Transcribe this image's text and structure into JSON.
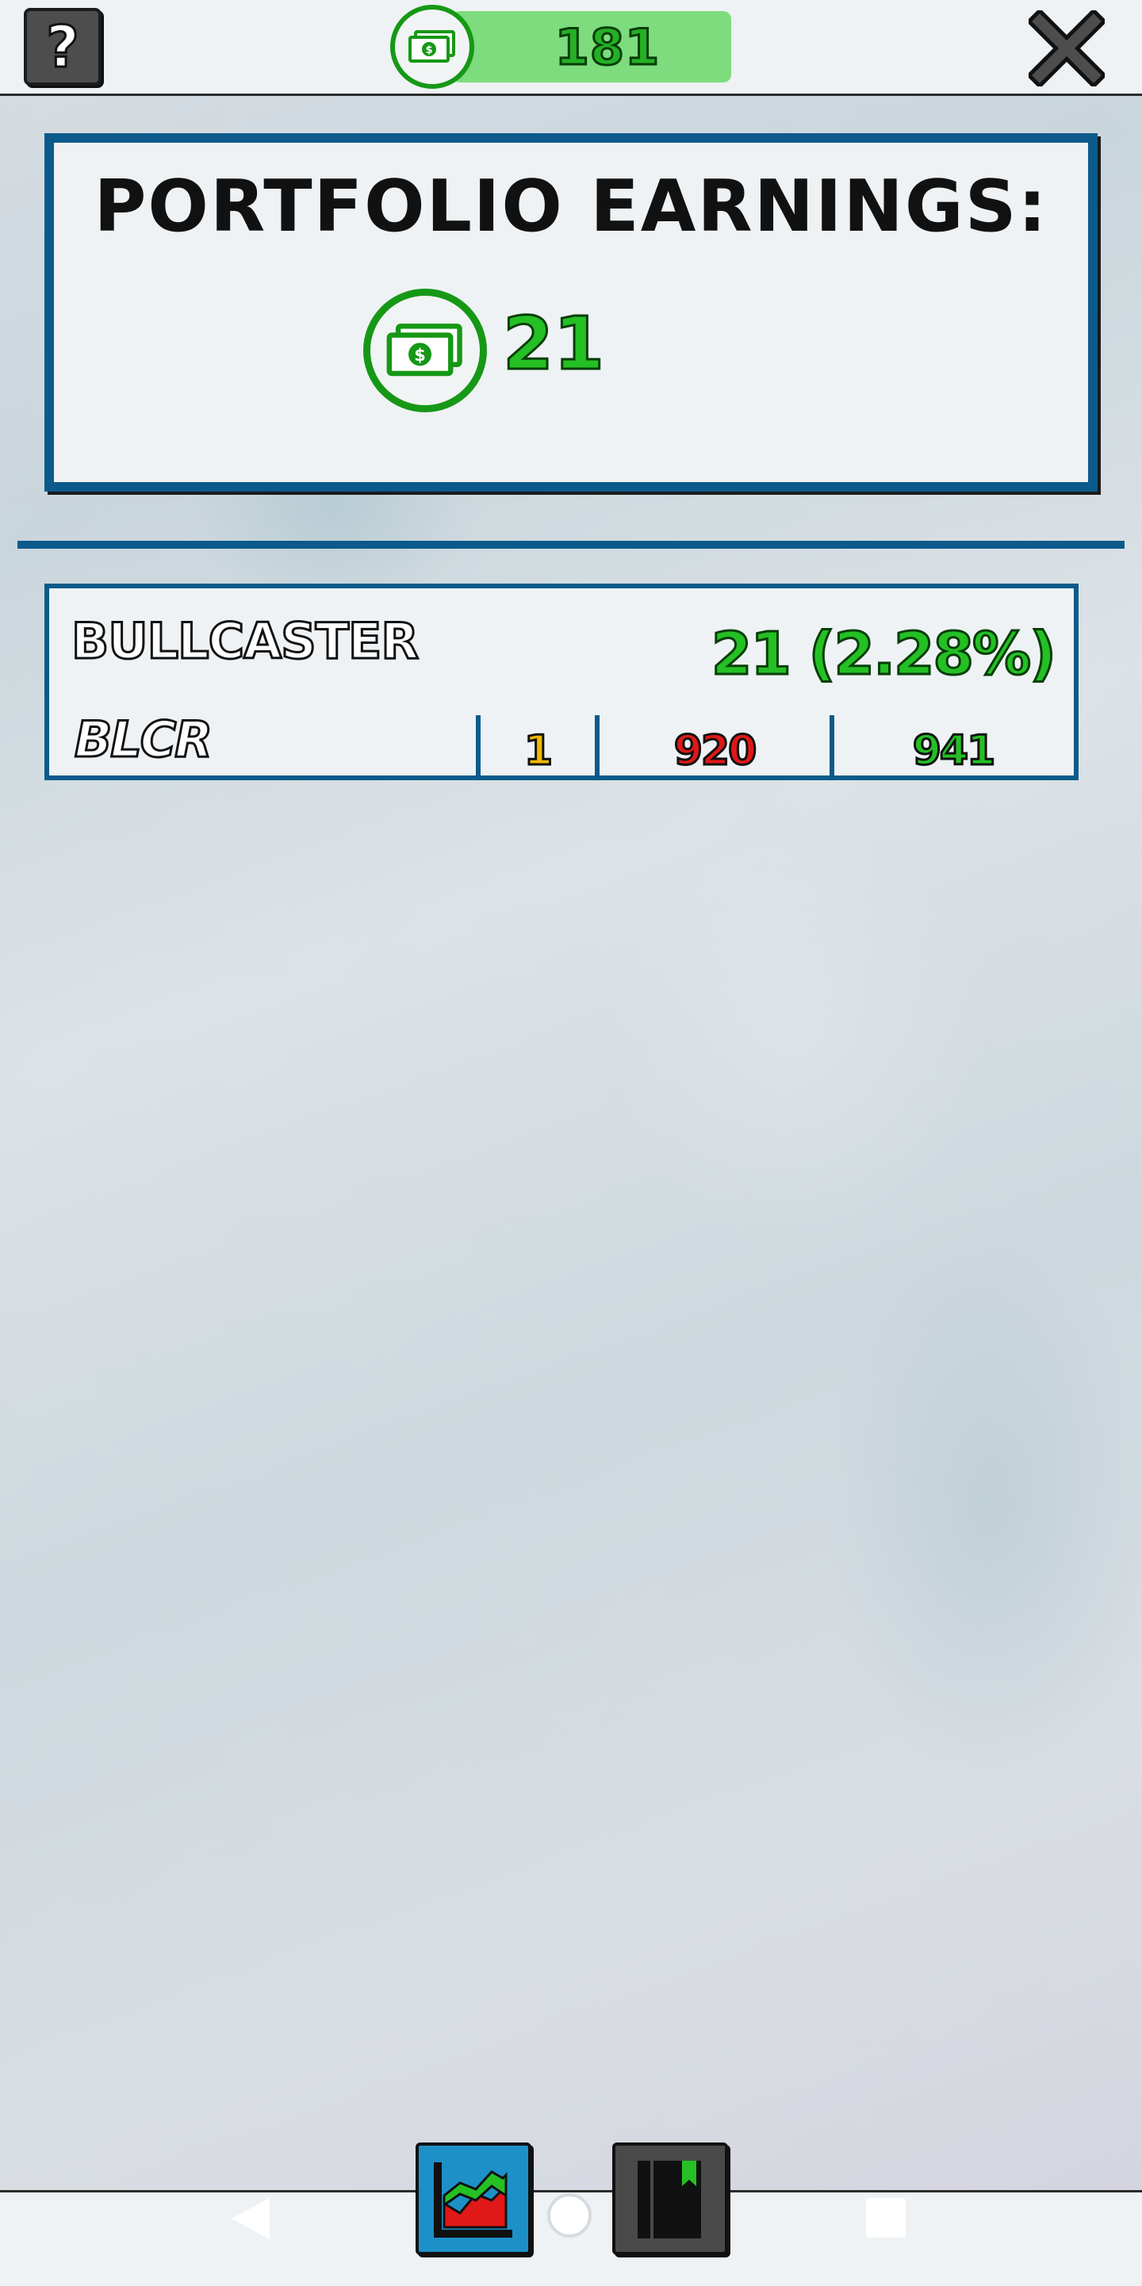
{
  "topbar": {
    "help_label": "?",
    "cash_value": "181",
    "icons": {
      "help": "question-icon",
      "cash": "cash-icon",
      "close": "close-icon"
    }
  },
  "earnings": {
    "title": "PORTFOLIO EARNINGS:",
    "value": "21",
    "icon": "cash-icon"
  },
  "stocks": [
    {
      "name": "BULLCASTER",
      "ticker": "BLCR",
      "change": "21 (2.28%)",
      "shares": "1",
      "bought": "920",
      "current": "941"
    }
  ],
  "tabs": [
    {
      "name": "portfolio",
      "icon": "chart-icon",
      "active": true
    },
    {
      "name": "journal",
      "icon": "book-icon",
      "active": false
    }
  ],
  "colors": {
    "accent": "#0c5a8b",
    "gain": "#24c024",
    "loss": "#e01818",
    "shares": "#f0b800",
    "cash_pill": "#7ddc7d"
  }
}
